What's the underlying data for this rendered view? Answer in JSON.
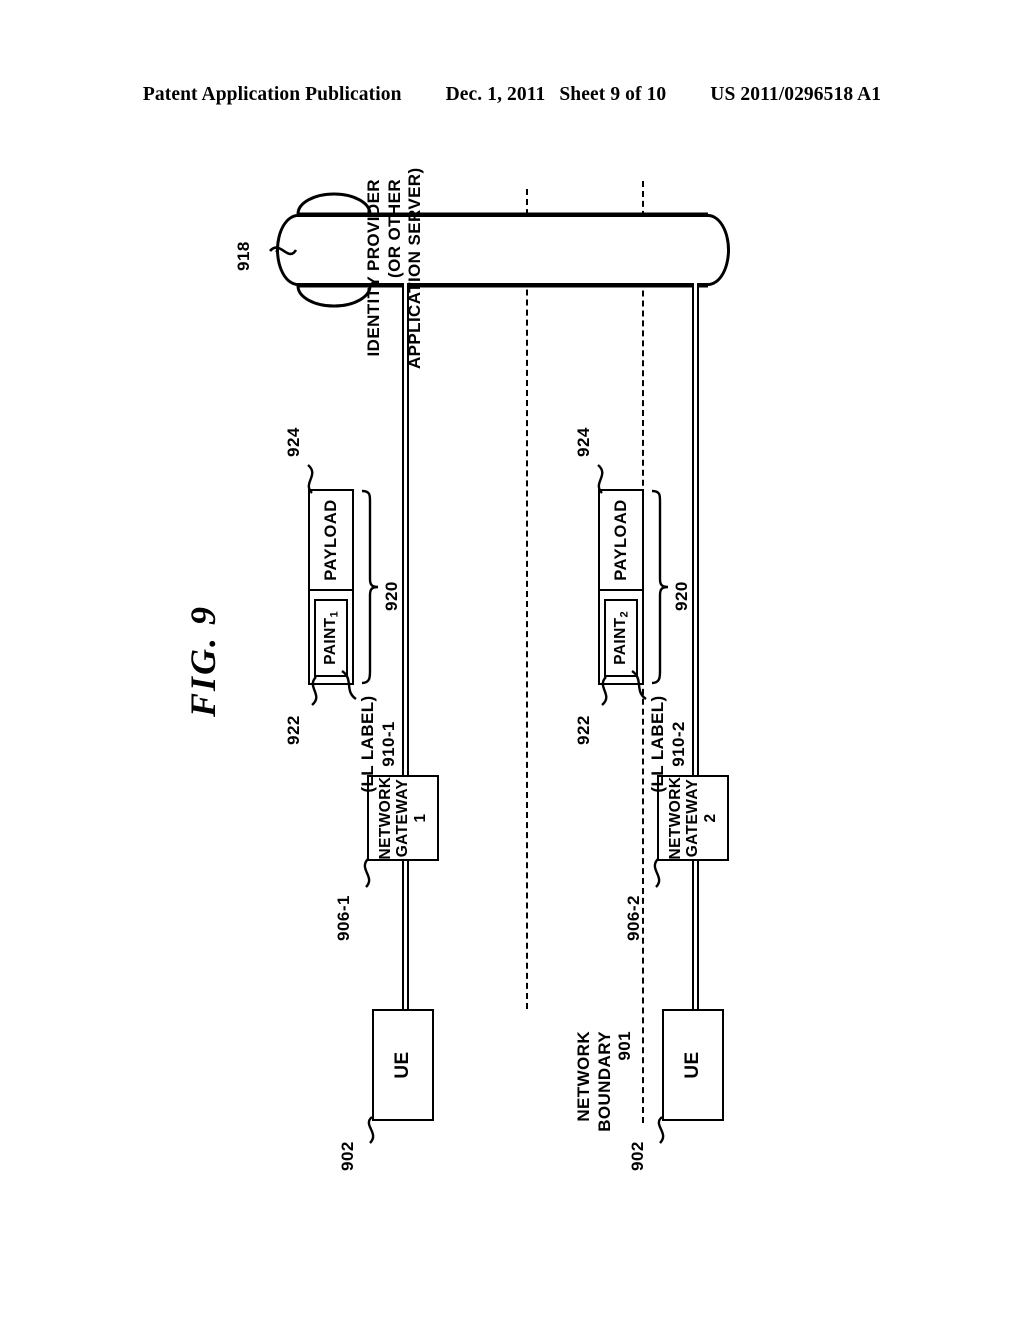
{
  "header": {
    "publication": "Patent Application Publication",
    "date": "Dec. 1, 2011",
    "sheet": "Sheet 9 of 10",
    "number": "US 2011/0296518 A1"
  },
  "figure": {
    "title": "FIG. 9",
    "server": {
      "label_line1": "IDENTITY PROVIDER",
      "label_line2": "(OR OTHER",
      "label_line3": "APPLICATION SERVER)",
      "ref": "918"
    },
    "boundary": {
      "label_line1": "NETWORK",
      "label_line2": "BOUNDARY",
      "ref": "901"
    },
    "branches": [
      {
        "gateway_line1": "NETWORK",
        "gateway_line2": "GATEWAY 1",
        "gateway_ref": "906-1",
        "ue_label": "UE",
        "ue_ref": "902",
        "packet_ref": "920",
        "header_field": "PAINT",
        "header_field_sub": "1",
        "header_field_ref": "922",
        "payload_field": "PAYLOAD",
        "payload_field_ref": "924",
        "ll_label_line1": "(LL LABEL)",
        "ll_label_line2": "910-1"
      },
      {
        "gateway_line1": "NETWORK",
        "gateway_line2": "GATEWAY 2",
        "gateway_ref": "906-2",
        "ue_label": "UE",
        "ue_ref": "902",
        "packet_ref": "920",
        "header_field": "PAINT",
        "header_field_sub": "2",
        "header_field_ref": "922",
        "payload_field": "PAYLOAD",
        "payload_field_ref": "924",
        "ll_label_line1": "(LL LABEL)",
        "ll_label_line2": "910-2"
      }
    ]
  }
}
